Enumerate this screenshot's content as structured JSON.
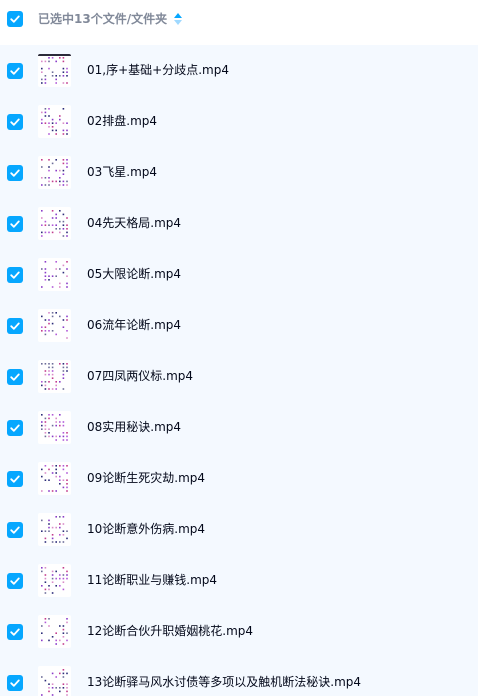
{
  "header": {
    "label": "已选中13个文件/文件夹",
    "select_all_checked": true,
    "sort_icon": "sort-icon"
  },
  "files": [
    {
      "name": "01,序+基础+分歧点.mp4",
      "checked": true,
      "thumb_icon": "video-thumbnail-icon"
    },
    {
      "name": "02排盘.mp4",
      "checked": true,
      "thumb_icon": "video-thumbnail-icon"
    },
    {
      "name": "03飞星.mp4",
      "checked": true,
      "thumb_icon": "video-thumbnail-icon"
    },
    {
      "name": "04先天格局.mp4",
      "checked": true,
      "thumb_icon": "video-thumbnail-icon"
    },
    {
      "name": "05大限论断.mp4",
      "checked": true,
      "thumb_icon": "video-thumbnail-icon"
    },
    {
      "name": "06流年论断.mp4",
      "checked": true,
      "thumb_icon": "video-thumbnail-icon"
    },
    {
      "name": "07四凤两仪标.mp4",
      "checked": true,
      "thumb_icon": "video-thumbnail-icon"
    },
    {
      "name": "08实用秘诀.mp4",
      "checked": true,
      "thumb_icon": "video-thumbnail-icon"
    },
    {
      "name": "09论断生死灾劫.mp4",
      "checked": true,
      "thumb_icon": "video-thumbnail-icon"
    },
    {
      "name": "10论断意外伤病.mp4",
      "checked": true,
      "thumb_icon": "video-thumbnail-icon"
    },
    {
      "name": "11论断职业与赚钱.mp4",
      "checked": true,
      "thumb_icon": "video-thumbnail-icon"
    },
    {
      "name": "12论断合伙升职婚姻桃花.mp4",
      "checked": true,
      "thumb_icon": "video-thumbnail-icon"
    },
    {
      "name": "13论断驿马风水讨债等多项以及触机断法秘诀.mp4",
      "checked": true,
      "thumb_icon": "video-thumbnail-icon"
    }
  ],
  "colors": {
    "accent": "#06a7ff",
    "list_background": "#f4f9ff",
    "header_text": "#818999",
    "file_text": "#03081a"
  }
}
